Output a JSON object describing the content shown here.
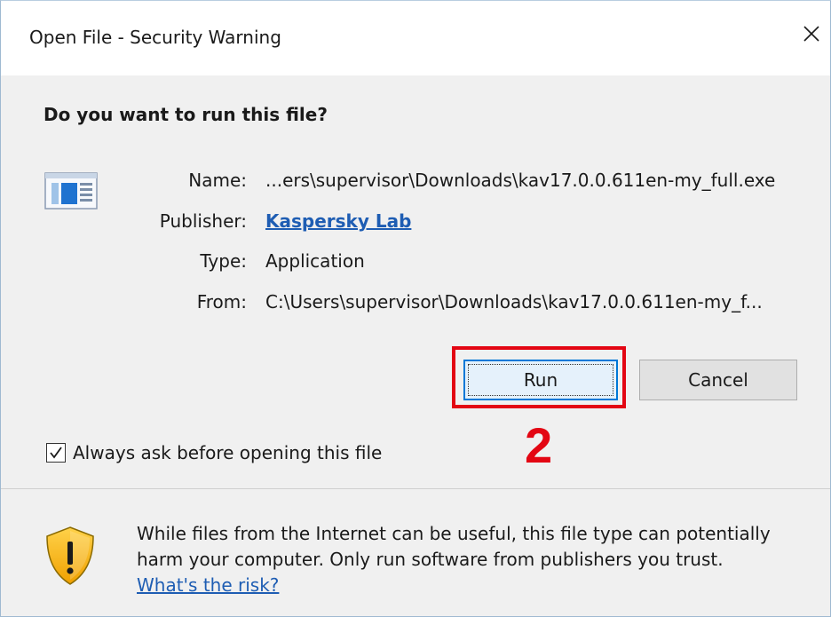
{
  "window": {
    "title": "Open File - Security Warning",
    "close_icon": "close-icon"
  },
  "prompt": {
    "question": "Do you want to run this file?"
  },
  "file": {
    "icon": "application-file-icon",
    "name_label": "Name:",
    "name_value": "...ers\\supervisor\\Downloads\\kav17.0.0.611en-my_full.exe",
    "publisher_label": "Publisher:",
    "publisher_value": "Kaspersky Lab",
    "type_label": "Type:",
    "type_value": "Application",
    "from_label": "From:",
    "from_value": "C:\\Users\\supervisor\\Downloads\\kav17.0.0.611en-my_f..."
  },
  "buttons": {
    "run_label": "Run",
    "cancel_label": "Cancel"
  },
  "annotation": {
    "step_number": "2",
    "highlight_color": "#e30613"
  },
  "options": {
    "always_ask_label": "Always ask before opening this file",
    "always_ask_checked": true
  },
  "warning": {
    "icon": "shield-warning-icon",
    "text": "While files from the Internet can be useful, this file type can potentially harm your computer. Only run software from publishers you trust.",
    "risk_link": "What's the risk?"
  },
  "colors": {
    "link": "#1e5db3",
    "accent": "#0078d7",
    "annotation_red": "#e30613"
  }
}
